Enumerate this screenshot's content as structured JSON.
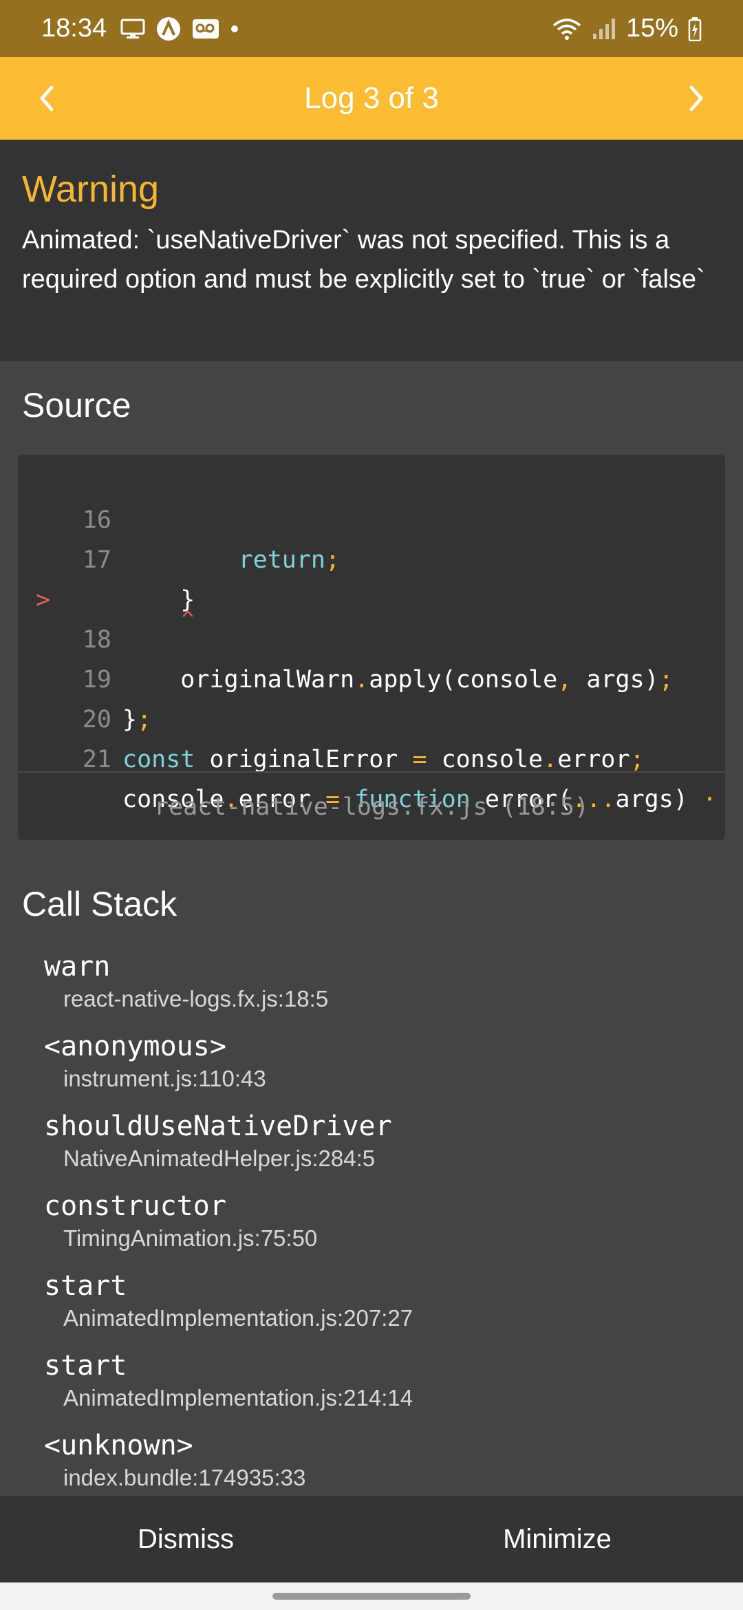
{
  "status_bar": {
    "time": "18:34",
    "left_icons": [
      "screen-share-icon",
      "app-a-icon",
      "voicemail-icon",
      "dot-icon"
    ],
    "battery": "15%"
  },
  "header": {
    "title": "Log 3 of 3",
    "accent": "#fbbb33"
  },
  "warning": {
    "title": "Warning",
    "message": "Animated: `useNativeDriver` was not specified. This is a required option and must be explicitly set to `true` or `false`"
  },
  "source": {
    "title": "Source",
    "lines": [
      {
        "num": "16",
        "text": "        return;",
        "highlighted": false
      },
      {
        "num": "17",
        "text": "    }",
        "highlighted": false
      },
      {
        "num": "18",
        "text": "    originalWarn.apply(console, args);",
        "highlighted": true
      },
      {
        "num": "19",
        "text": "};",
        "highlighted": false
      },
      {
        "num": "20",
        "text": "const originalError = console.error;",
        "highlighted": false
      },
      {
        "num": "21",
        "text": "console.error = function error(...args) ·",
        "highlighted": false
      }
    ],
    "marker": ">",
    "caret": "^",
    "file": "react-native-logs.fx.js (18:5)"
  },
  "call_stack": {
    "title": "Call Stack",
    "frames": [
      {
        "fn": "warn",
        "loc": "react-native-logs.fx.js:18:5"
      },
      {
        "fn": "<anonymous>",
        "loc": "instrument.js:110:43"
      },
      {
        "fn": "shouldUseNativeDriver",
        "loc": "NativeAnimatedHelper.js:284:5"
      },
      {
        "fn": "constructor",
        "loc": "TimingAnimation.js:75:50"
      },
      {
        "fn": "start",
        "loc": "AnimatedImplementation.js:207:27"
      },
      {
        "fn": "start",
        "loc": "AnimatedImplementation.js:214:14"
      },
      {
        "fn": "<unknown>",
        "loc": "index.bundle:174935:33"
      }
    ]
  },
  "footer": {
    "dismiss": "Dismiss",
    "minimize": "Minimize"
  }
}
